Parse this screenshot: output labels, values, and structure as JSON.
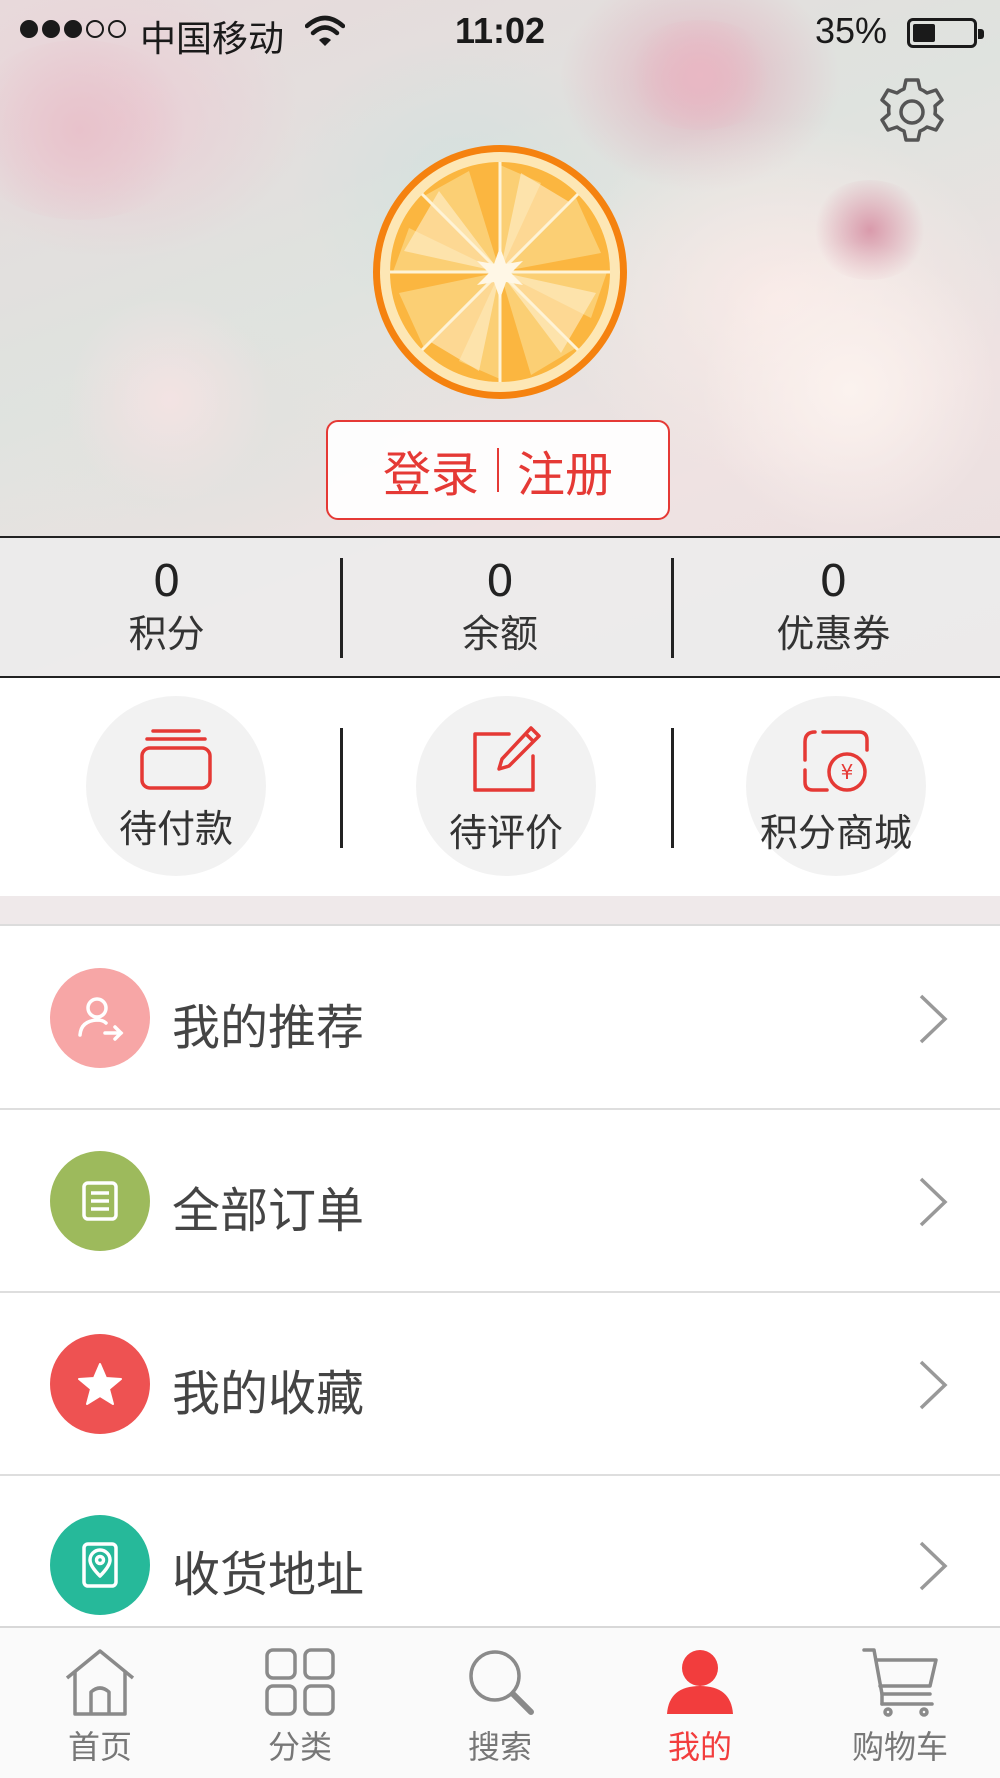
{
  "status_bar": {
    "carrier": "中国移动",
    "time": "11:02",
    "battery": "35%",
    "battery_level": 0.35,
    "signal_bars": 3,
    "signal_total": 5
  },
  "header": {
    "login": "登录",
    "register": "注册"
  },
  "stats": [
    {
      "value": "0",
      "label": "积分"
    },
    {
      "value": "0",
      "label": "余额"
    },
    {
      "value": "0",
      "label": "优惠券"
    }
  ],
  "shortcuts": [
    {
      "label": "待付款",
      "icon": "wallet-icon"
    },
    {
      "label": "待评价",
      "icon": "edit-icon"
    },
    {
      "label": "积分商城",
      "icon": "points-mall-icon"
    }
  ],
  "menu": [
    {
      "label": "我的推荐",
      "icon": "user-share-icon",
      "color": "#f7a6a6"
    },
    {
      "label": "全部订单",
      "icon": "list-icon",
      "color": "#9dba5c"
    },
    {
      "label": "我的收藏",
      "icon": "star-icon",
      "color": "#ee5252"
    },
    {
      "label": "收货地址",
      "icon": "location-icon",
      "color": "#26b99a"
    }
  ],
  "tabbar": [
    {
      "label": "首页",
      "icon": "home-icon"
    },
    {
      "label": "分类",
      "icon": "grid-icon"
    },
    {
      "label": "搜索",
      "icon": "search-icon"
    },
    {
      "label": "我的",
      "icon": "profile-icon",
      "active": true
    },
    {
      "label": "购物车",
      "icon": "cart-icon"
    }
  ],
  "colors": {
    "accent": "#f23d3d",
    "text": "#444444"
  }
}
